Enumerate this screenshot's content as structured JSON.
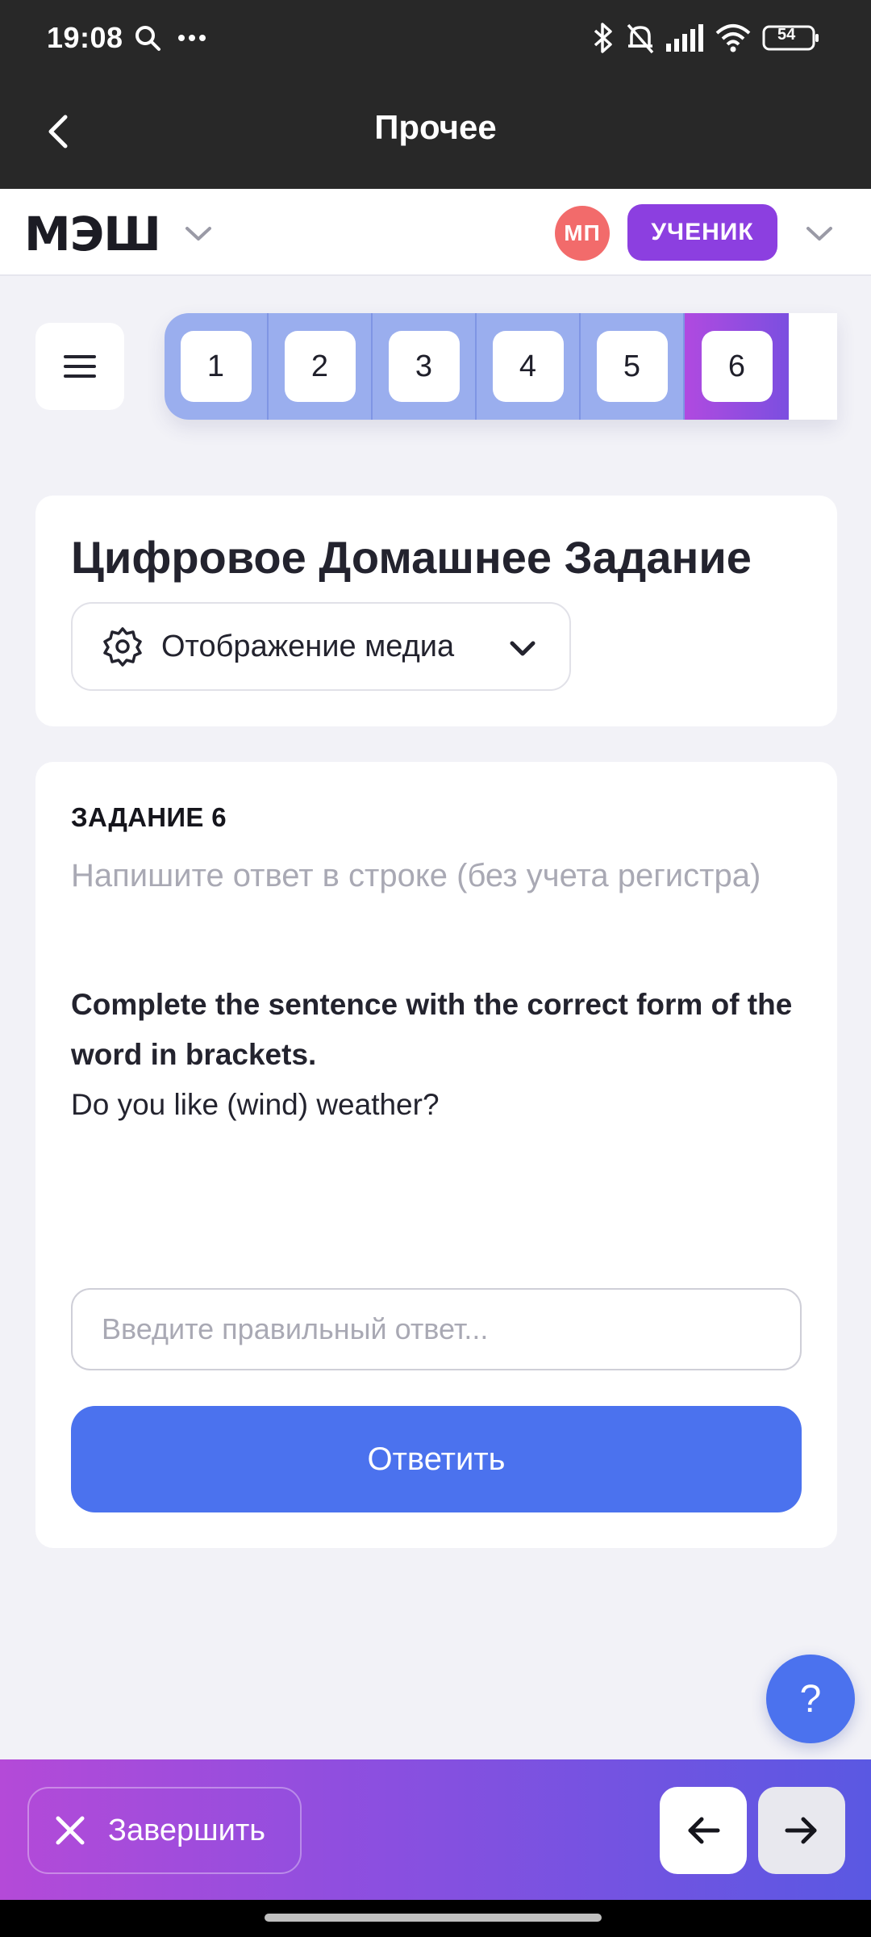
{
  "status_bar": {
    "time": "19:08",
    "battery": "54"
  },
  "app_bar": {
    "title": "Прочее"
  },
  "header": {
    "logo": "МЭШ",
    "avatar_initials": "МП",
    "role": "УЧЕНИК"
  },
  "tasks_nav": {
    "items": [
      "1",
      "2",
      "3",
      "4",
      "5",
      "6"
    ],
    "active_index": 5
  },
  "homework": {
    "title": "Цифровое Домашнее Задание",
    "media_select_label": "Отображение медиа"
  },
  "task": {
    "label": "ЗАДАНИЕ 6",
    "hint": "Напишите ответ в строке (без учета регистра)",
    "question": "Complete the sentence  with the correct form of the word in brackets.",
    "sentence": "Do you like (wind) weather?",
    "input_placeholder": "Введите правильный ответ...",
    "input_value": "",
    "submit_label": "Ответить"
  },
  "help": {
    "label": "?"
  },
  "bottom_bar": {
    "finish_label": "Завершить"
  },
  "colors": {
    "accent": "#4b72ee",
    "brand_purple": "#8c3fe0",
    "avatar": "#f26b6b",
    "task_cell": "#9aaeee"
  }
}
